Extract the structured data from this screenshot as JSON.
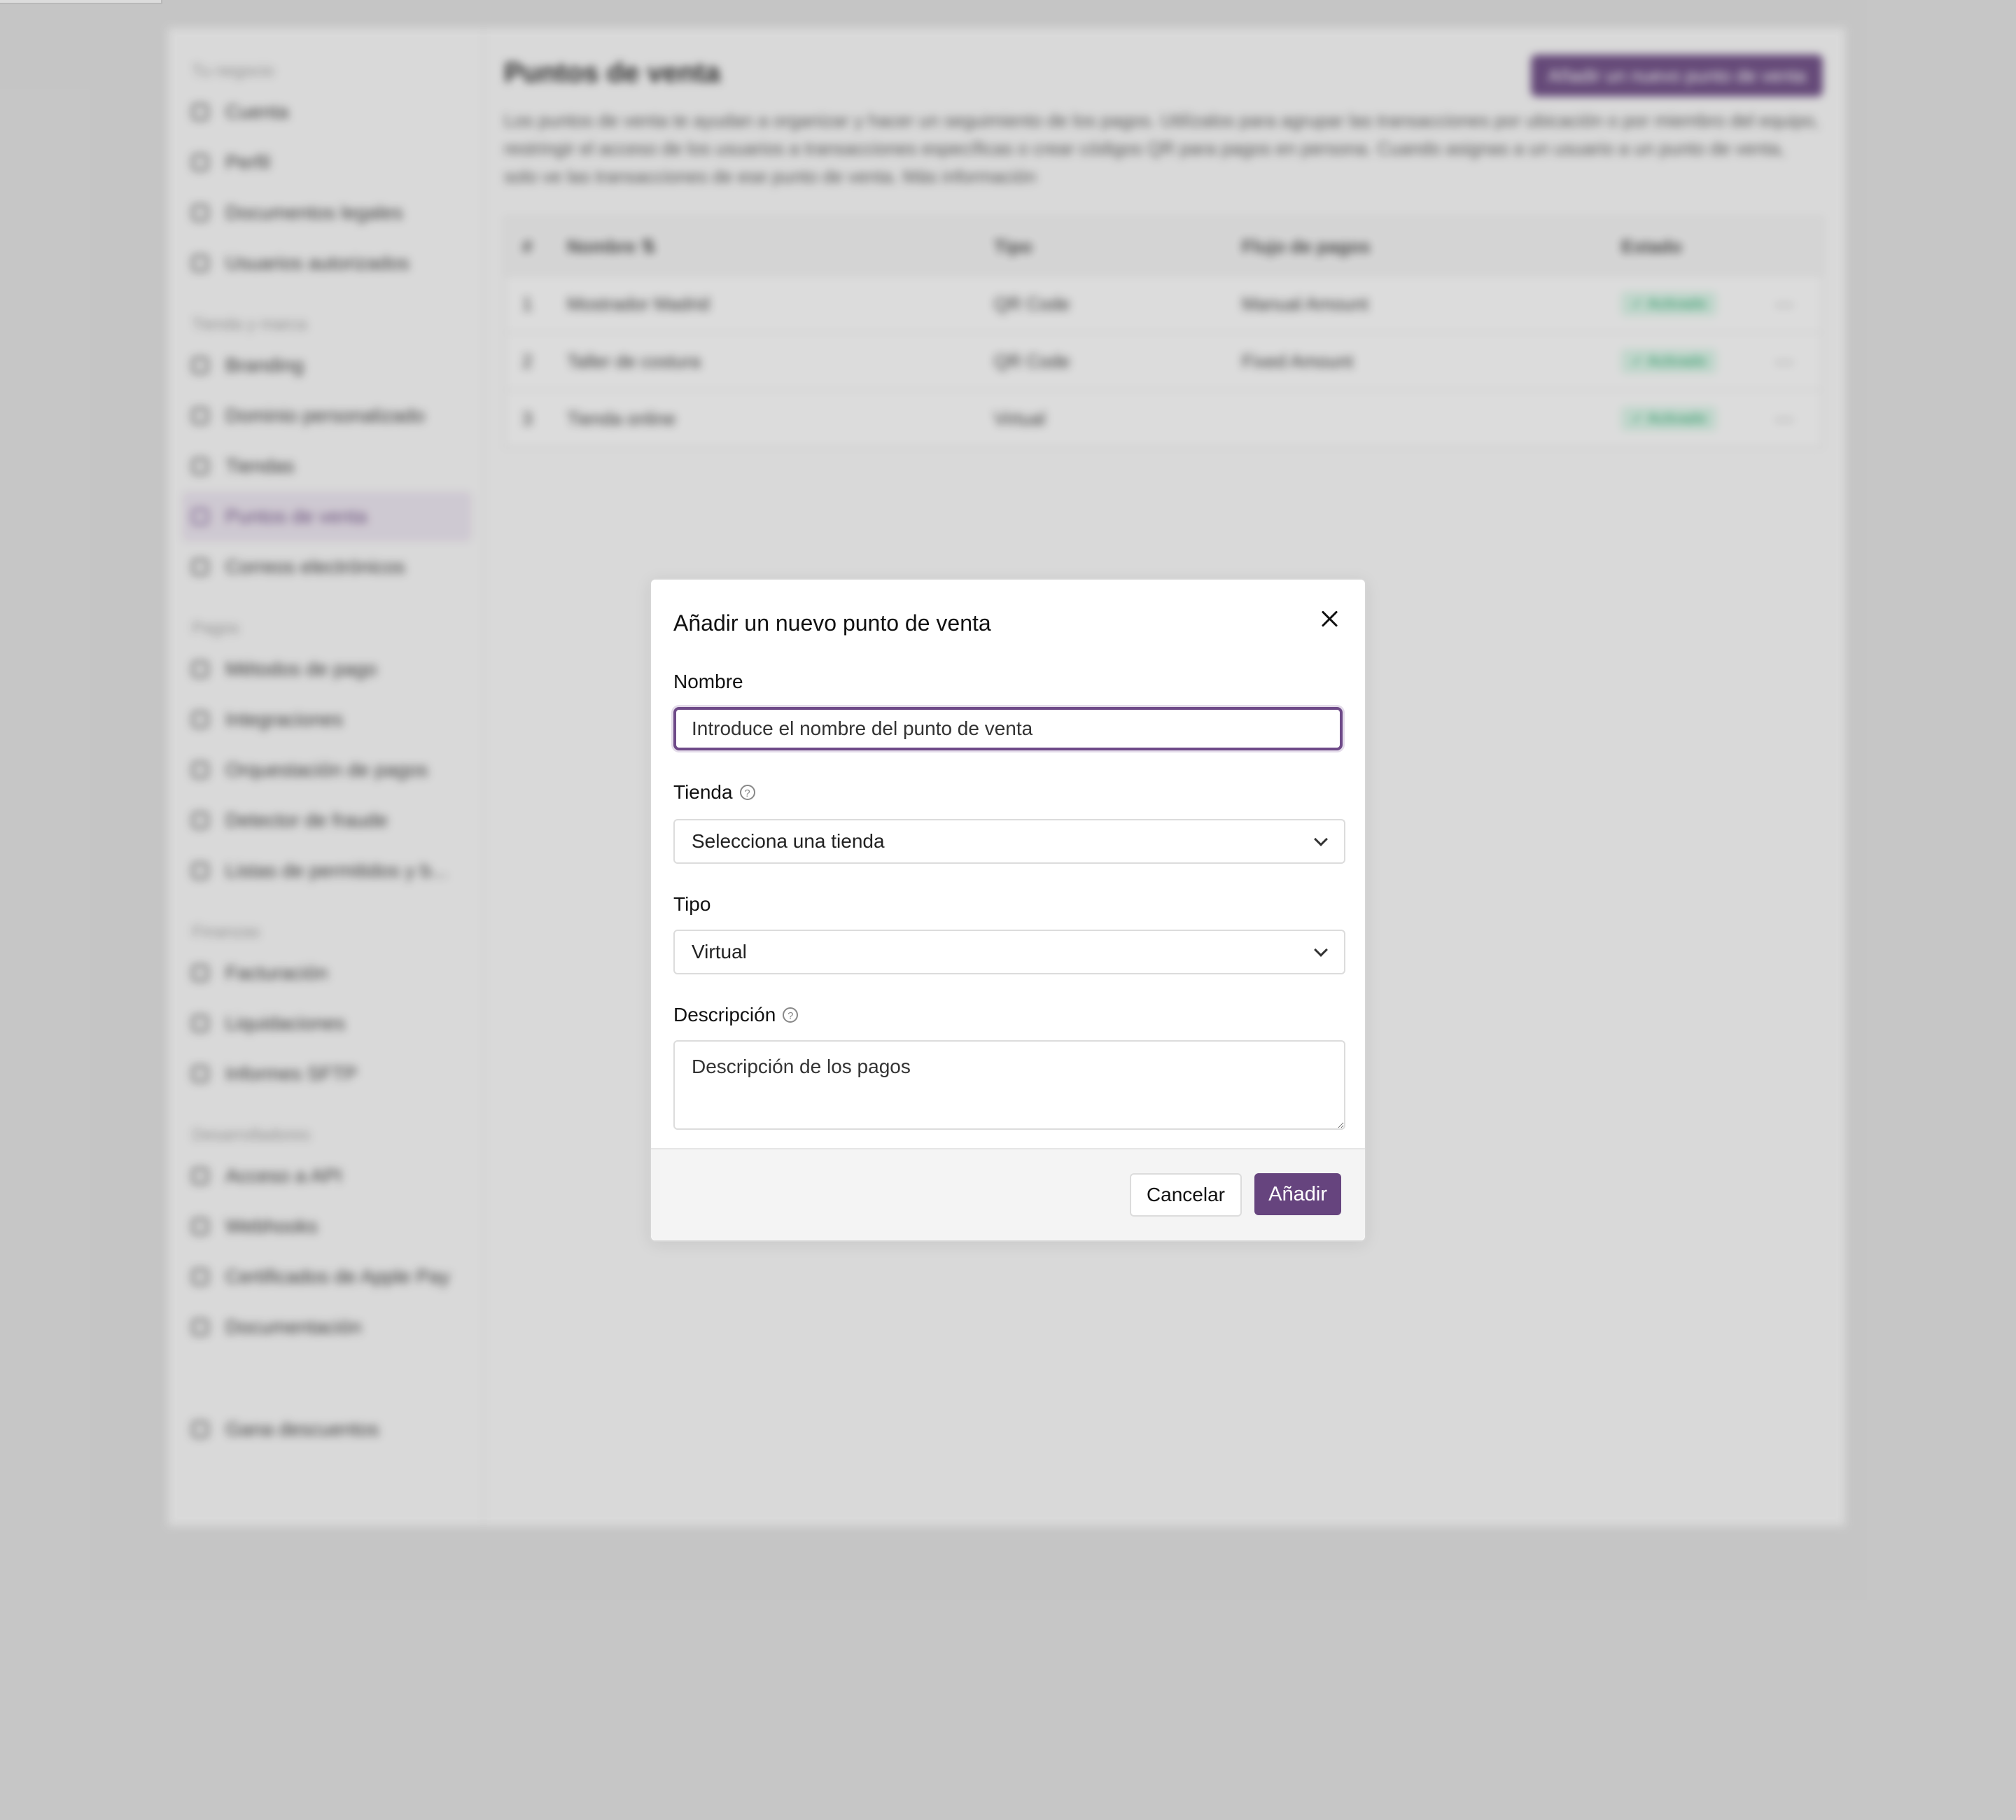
{
  "background": {
    "sidebar": {
      "sections": [
        {
          "heading": "Tu negocio",
          "items": [
            "Cuenta",
            "Perfil",
            "Documentos legales",
            "Usuarios autorizados"
          ]
        },
        {
          "heading": "Tienda y marca",
          "items": [
            "Branding",
            "Dominio personalizado",
            "Tiendas",
            "Puntos de venta",
            "Correos electrónicos"
          ]
        },
        {
          "heading": "Pagos",
          "items": [
            "Métodos de pago",
            "Integraciones",
            "Orquestación de pagos",
            "Detector de fraude",
            "Listas de permitidos y b..."
          ]
        },
        {
          "heading": "Finanzas",
          "items": [
            "Facturación",
            "Liquidaciones",
            "Informes SFTP"
          ]
        },
        {
          "heading": "Desarrolladores",
          "items": [
            "Acceso a API",
            "Webhooks",
            "Certificados de Apple Pay",
            "Documentación"
          ]
        },
        {
          "heading": "",
          "items": [
            "Gana descuentos"
          ]
        }
      ],
      "active_item": "Puntos de venta"
    },
    "page_title": "Puntos de venta",
    "add_button": "Añadir un nuevo punto de venta",
    "description": "Los puntos de venta te ayudan a organizar y hacer un seguimiento de los pagos. Utilízalos para agrupar las transacciones por ubicación o por miembro del equipo, restringir el acceso de los usuarios a transacciones específicas o crear códigos QR para pagos en persona. Cuando asignas a un usuario a un punto de venta, solo ve las transacciones de ese punto de venta. Más información",
    "table": {
      "headers": [
        "#",
        "Nombre ⇅",
        "Tipo",
        "Flujo de pagos",
        "Estado"
      ],
      "rows": [
        {
          "num": "1",
          "name": "Mostrador Madrid",
          "type": "QR Code",
          "flow": "Manual Amount",
          "status": "✓ Activado"
        },
        {
          "num": "2",
          "name": "Taller de costura",
          "type": "QR Code",
          "flow": "Fixed Amount",
          "status": "✓ Activado"
        },
        {
          "num": "3",
          "name": "Tienda online",
          "type": "Virtual",
          "flow": "",
          "status": "✓ Activado"
        }
      ],
      "row_menu": "···"
    }
  },
  "modal": {
    "title": "Añadir un nuevo punto de venta",
    "name_label": "Nombre",
    "name_placeholder": "Introduce el nombre del punto de venta",
    "store_label": "Tienda",
    "store_value": "Selecciona una tienda",
    "type_label": "Tipo",
    "type_value": "Virtual",
    "description_label": "Descripción",
    "description_placeholder": "Descripción de los pagos",
    "help_glyph": "?",
    "cancel_label": "Cancelar",
    "add_label": "Añadir"
  },
  "colors": {
    "accent": "#66447e",
    "success": "#28a36a"
  }
}
